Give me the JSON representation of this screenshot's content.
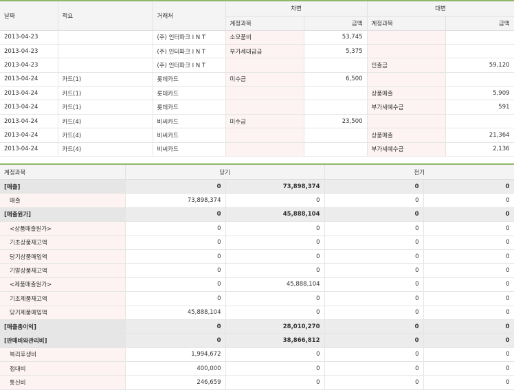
{
  "journal": {
    "headers": {
      "date": "날짜",
      "memo": "적요",
      "partner": "거래처",
      "debit": "차변",
      "credit": "대변",
      "debit_account": "계정과목",
      "debit_amount": "금액",
      "credit_account": "계정과목",
      "credit_amount": "금액"
    },
    "rows": [
      {
        "date": "2013-04-23",
        "memo": "",
        "partner": "(주) 인터파크 I N T",
        "debit_account": "소모품비",
        "debit_amount": "53,745",
        "credit_account": "",
        "credit_amount": ""
      },
      {
        "date": "2013-04-23",
        "memo": "",
        "partner": "(주) 인터파크 I N T",
        "debit_account": "부가세대급금",
        "debit_amount": "5,375",
        "credit_account": "",
        "credit_amount": ""
      },
      {
        "date": "2013-04-23",
        "memo": "",
        "partner": "(주) 인터파크 I N T",
        "debit_account": "",
        "debit_amount": "",
        "credit_account": "인출금",
        "credit_amount": "59,120"
      },
      {
        "date": "2013-04-24",
        "memo": "카드(1)",
        "partner": "롯데카드",
        "debit_account": "미수금",
        "debit_amount": "6,500",
        "credit_account": "",
        "credit_amount": ""
      },
      {
        "date": "2013-04-24",
        "memo": "카드(1)",
        "partner": "롯데카드",
        "debit_account": "",
        "debit_amount": "",
        "credit_account": "상품매출",
        "credit_amount": "5,909"
      },
      {
        "date": "2013-04-24",
        "memo": "카드(1)",
        "partner": "롯데카드",
        "debit_account": "",
        "debit_amount": "",
        "credit_account": "부가세예수금",
        "credit_amount": "591"
      },
      {
        "date": "2013-04-24",
        "memo": "카드(4)",
        "partner": "비씨카드",
        "debit_account": "미수금",
        "debit_amount": "23,500",
        "credit_account": "",
        "credit_amount": ""
      },
      {
        "date": "2013-04-24",
        "memo": "카드(4)",
        "partner": "비씨카드",
        "debit_account": "",
        "debit_amount": "",
        "credit_account": "상품매출",
        "credit_amount": "21,364"
      },
      {
        "date": "2013-04-24",
        "memo": "카드(4)",
        "partner": "비씨카드",
        "debit_account": "",
        "debit_amount": "",
        "credit_account": "부가세예수금",
        "credit_amount": "2,136"
      }
    ]
  },
  "summary": {
    "headers": {
      "account": "계정과목",
      "current": "당기",
      "previous": "전기"
    },
    "rows": [
      {
        "name": "[매출]",
        "c1": "0",
        "c2": "73,898,374",
        "p1": "0",
        "p2": "0",
        "group": true
      },
      {
        "name": "매출",
        "c1": "73,898,374",
        "c2": "0",
        "p1": "0",
        "p2": "0",
        "group": false
      },
      {
        "name": "[매출원가]",
        "c1": "0",
        "c2": "45,888,104",
        "p1": "0",
        "p2": "0",
        "group": true
      },
      {
        "name": "<상품매출원가>",
        "c1": "0",
        "c2": "0",
        "p1": "0",
        "p2": "0",
        "group": false
      },
      {
        "name": "기초상품재고액",
        "c1": "0",
        "c2": "0",
        "p1": "0",
        "p2": "0",
        "group": false
      },
      {
        "name": "당기상품매입액",
        "c1": "0",
        "c2": "0",
        "p1": "0",
        "p2": "0",
        "group": false
      },
      {
        "name": "기말상품재고액",
        "c1": "0",
        "c2": "0",
        "p1": "0",
        "p2": "0",
        "group": false
      },
      {
        "name": "<제품매출원가>",
        "c1": "0",
        "c2": "45,888,104",
        "p1": "0",
        "p2": "0",
        "group": false
      },
      {
        "name": "기초제품재고액",
        "c1": "0",
        "c2": "0",
        "p1": "0",
        "p2": "0",
        "group": false
      },
      {
        "name": "당기제품매입액",
        "c1": "45,888,104",
        "c2": "0",
        "p1": "0",
        "p2": "0",
        "group": false
      },
      {
        "name": "[매출총이익]",
        "c1": "0",
        "c2": "28,010,270",
        "p1": "0",
        "p2": "0",
        "group": true
      },
      {
        "name": "[판매비와관리비]",
        "c1": "0",
        "c2": "38,866,812",
        "p1": "0",
        "p2": "0",
        "group": true
      },
      {
        "name": "복리후생비",
        "c1": "1,994,672",
        "c2": "0",
        "p1": "0",
        "p2": "0",
        "group": false
      },
      {
        "name": "접대비",
        "c1": "400,000",
        "c2": "0",
        "p1": "0",
        "p2": "0",
        "group": false
      },
      {
        "name": "통신비",
        "c1": "246,659",
        "c2": "0",
        "p1": "0",
        "p2": "0",
        "group": false
      }
    ]
  }
}
